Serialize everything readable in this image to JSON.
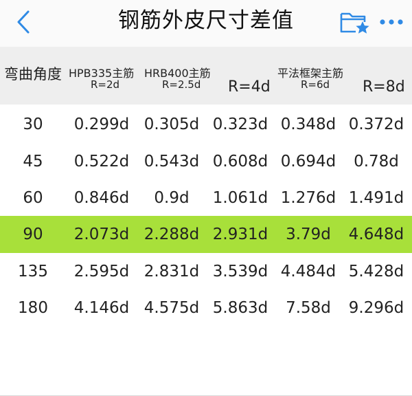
{
  "header": {
    "title": "钢筋外皮尺寸差值",
    "back_icon": "chevron-left-icon",
    "folder_icon": "folder-star-icon",
    "more_icon": "more-dots-icon",
    "accent_color": "#2f8ae5"
  },
  "table": {
    "highlight_color": "#a8e03a",
    "header_bg": "#eeeeee",
    "columns": {
      "angle": "弯曲角度",
      "hpb335": {
        "name": "HPB335主筋",
        "r": "R=2d"
      },
      "hrb400": {
        "name": "HRB400主筋",
        "r": "R=2.5d"
      },
      "r4": "R=4d",
      "frame": {
        "name": "平法框架主筋",
        "r": "R=6d"
      },
      "r8": "R=8d"
    },
    "rows": [
      [
        "30",
        "0.299d",
        "0.305d",
        "0.323d",
        "0.348d",
        "0.372d"
      ],
      [
        "45",
        "0.522d",
        "0.543d",
        "0.608d",
        "0.694d",
        "0.78d"
      ],
      [
        "60",
        "0.846d",
        "0.9d",
        "1.061d",
        "1.276d",
        "1.491d"
      ],
      [
        "90",
        "2.073d",
        "2.288d",
        "2.931d",
        "3.79d",
        "4.648d"
      ],
      [
        "135",
        "2.595d",
        "2.831d",
        "3.539d",
        "4.484d",
        "5.428d"
      ],
      [
        "180",
        "4.146d",
        "4.575d",
        "5.863d",
        "7.58d",
        "9.296d"
      ]
    ],
    "highlighted_row": "90"
  }
}
